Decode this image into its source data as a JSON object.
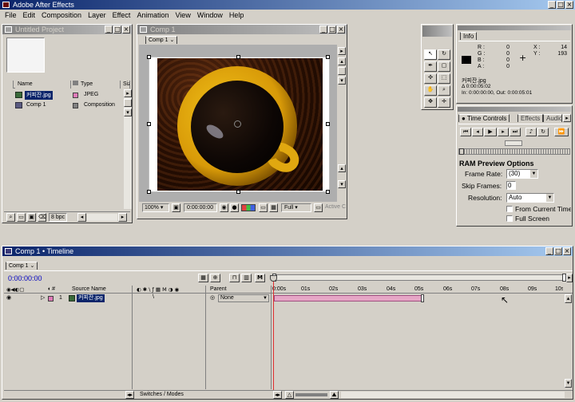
{
  "app": {
    "title": "Adobe After Effects"
  },
  "menu": [
    "File",
    "Edit",
    "Composition",
    "Layer",
    "Effect",
    "Animation",
    "View",
    "Window",
    "Help"
  ],
  "project": {
    "title": "Untitled Project",
    "columns": {
      "name": "Name",
      "type": "Type",
      "size": "Size"
    },
    "items": [
      {
        "name": "커피잔.jpg",
        "type": "JPEG",
        "color": "#e07ab8"
      },
      {
        "name": "Comp 1",
        "type": "Composition",
        "color": "#808080"
      }
    ],
    "footer": {
      "bpc": "8 bpc"
    }
  },
  "comp_window": {
    "title": "Comp 1",
    "tab": "Comp 1",
    "zoom": "100%",
    "time": "0:00:00:00",
    "resolution": "Full",
    "camera": "Active C"
  },
  "info": {
    "tab": "Info",
    "r": "0",
    "g": "0",
    "b": "0",
    "a": "0",
    "x": "14",
    "y": "193",
    "file": "커피잔.jpg",
    "duration": "Δ 0:00:05:02",
    "inout": "In: 0:00:00:00,  Out: 0:00:05:01"
  },
  "time_controls": {
    "tabs": [
      "Time Controls",
      "Effects",
      "Audio"
    ],
    "ram_title": "RAM Preview Options",
    "frame_rate_label": "Frame Rate:",
    "frame_rate": "(30)",
    "skip_label": "Skip Frames:",
    "skip": "0",
    "resolution_label": "Resolution:",
    "resolution": "Auto",
    "from_current": "From Current Time",
    "full_screen": "Full Screen"
  },
  "timeline": {
    "title": "Comp 1 • Timeline",
    "tab": "Comp 1",
    "time": "0:00:00:00",
    "source_name_header": "Source Name",
    "parent_header": "Parent",
    "layer_num": "1",
    "layer_name": "커피잔.jpg",
    "parent_value": "None",
    "ruler": [
      "0:00s",
      "01s",
      "02s",
      "03s",
      "04s",
      "05s",
      "06s",
      "07s",
      "08s",
      "09s",
      "10s"
    ],
    "switches_label": "Switches / Modes"
  }
}
